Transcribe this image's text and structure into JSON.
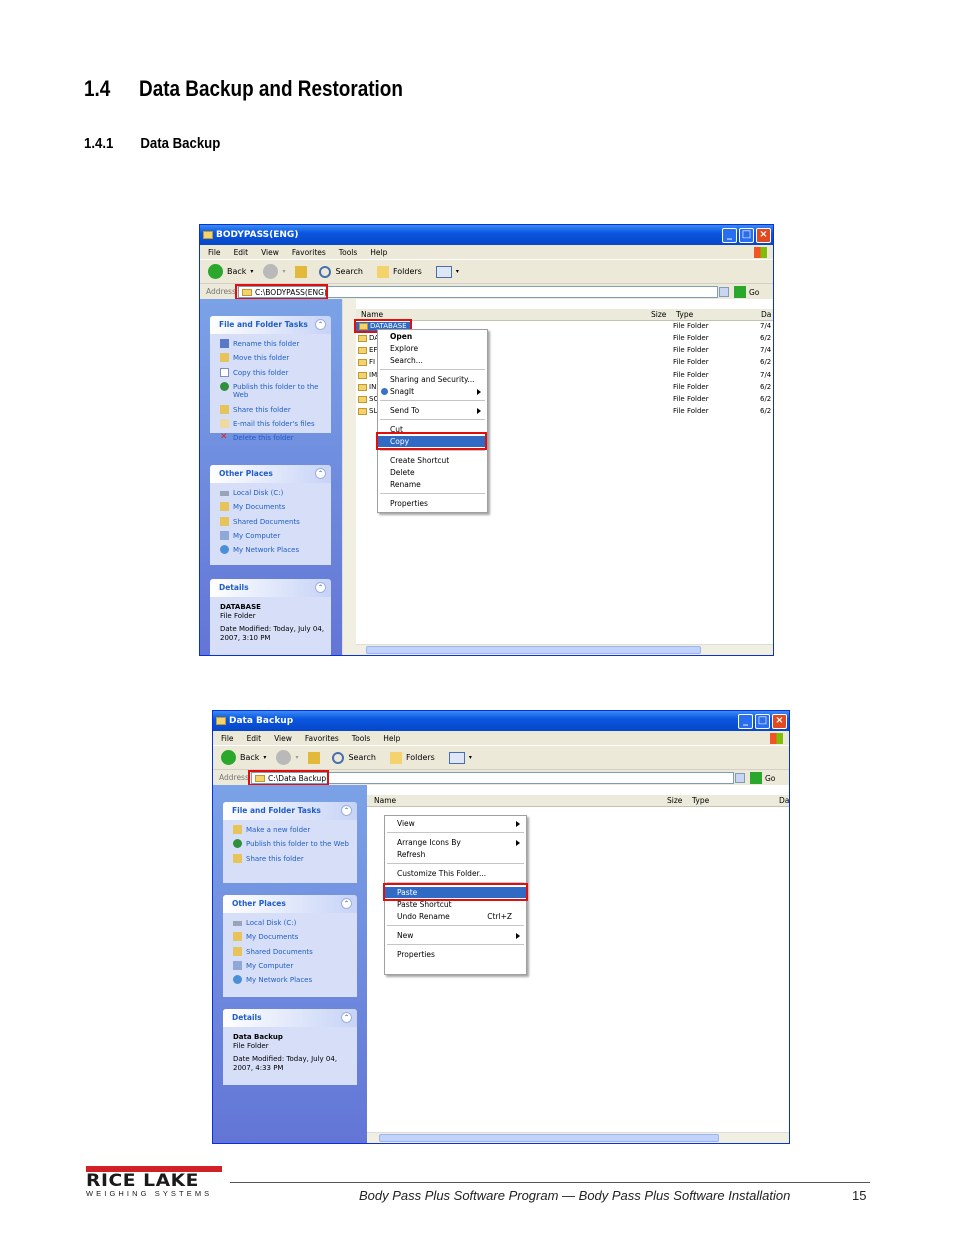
{
  "doc": {
    "section_num": "1.4",
    "section_title": "Data Backup and Restoration",
    "subsection_num": "1.4.1",
    "subsection_title": "Data Backup"
  },
  "window1": {
    "title": "BODYPASS(ENG)",
    "menu": [
      "File",
      "Edit",
      "View",
      "Favorites",
      "Tools",
      "Help"
    ],
    "toolbar": {
      "back": "Back",
      "search": "Search",
      "folders": "Folders"
    },
    "address_label": "Address",
    "address_value": "C:\\BODYPASS(ENG)",
    "go": "Go",
    "tasks_header": "File and Folder Tasks",
    "tasks": [
      "Rename this folder",
      "Move this folder",
      "Copy this folder",
      "Publish this folder to the Web",
      "Share this folder",
      "E-mail this folder's files",
      "Delete this folder"
    ],
    "places_header": "Other Places",
    "places": [
      "Local Disk (C:)",
      "My Documents",
      "Shared Documents",
      "My Computer",
      "My Network Places"
    ],
    "details_header": "Details",
    "details_name": "DATABASE",
    "details_type": "File Folder",
    "details_modified": "Date Modified: Today, July 04, 2007, 3:10 PM",
    "columns": {
      "name": "Name",
      "size": "Size",
      "type": "Type",
      "date": "Da"
    },
    "selected_item": "DATABASE",
    "file_prefixes": [
      "DA",
      "EF",
      "FI",
      "IM",
      "IN",
      "SC",
      "SL"
    ],
    "file_types": [
      "File Folder",
      "File Folder",
      "File Folder",
      "File Folder",
      "File Folder",
      "File Folder",
      "File Folder",
      "File Folder"
    ],
    "file_dates": [
      "7/4",
      "6/2",
      "7/4",
      "6/2",
      "7/4",
      "6/2",
      "6/2",
      "6/2"
    ],
    "context_menu": [
      "Open",
      "Explore",
      "Search...",
      "Sharing and Security...",
      "SnagIt",
      "Send To",
      "Cut",
      "Copy",
      "Create Shortcut",
      "Delete",
      "Rename",
      "Properties"
    ]
  },
  "window2": {
    "title": "Data Backup",
    "menu": [
      "File",
      "Edit",
      "View",
      "Favorites",
      "Tools",
      "Help"
    ],
    "toolbar": {
      "back": "Back",
      "search": "Search",
      "folders": "Folders"
    },
    "address_label": "Address",
    "address_value": "C:\\Data Backup",
    "go": "Go",
    "tasks_header": "File and Folder Tasks",
    "tasks": [
      "Make a new folder",
      "Publish this folder to the Web",
      "Share this folder"
    ],
    "places_header": "Other Places",
    "places": [
      "Local Disk (C:)",
      "My Documents",
      "Shared Documents",
      "My Computer",
      "My Network Places"
    ],
    "details_header": "Details",
    "details_name": "Data Backup",
    "details_type": "File Folder",
    "details_modified": "Date Modified: Today, July 04, 2007, 4:33 PM",
    "columns": {
      "name": "Name",
      "size": "Size",
      "type": "Type",
      "date": "Da"
    },
    "context_menu": [
      "View",
      "Arrange Icons By",
      "Refresh",
      "Customize This Folder...",
      "Paste",
      "Paste Shortcut",
      "Undo Rename",
      "New",
      "Properties"
    ],
    "undo_shortcut": "Ctrl+Z"
  },
  "footer": {
    "logo_name": "RICE LAKE",
    "logo_sub": "WEIGHING SYSTEMS",
    "text": "Body Pass Plus Software Program  — Body Pass Plus Software Installation",
    "page": "15"
  }
}
